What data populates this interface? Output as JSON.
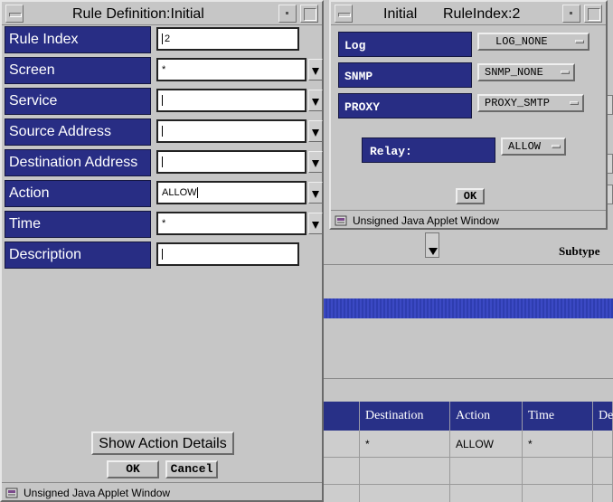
{
  "rule_definition": {
    "title": "Rule Definition:Initial",
    "fields": [
      {
        "label": "Rule Index",
        "value": "2"
      },
      {
        "label": "Screen",
        "value": "*"
      },
      {
        "label": "Service",
        "value": ""
      },
      {
        "label": "Source Address",
        "value": ""
      },
      {
        "label": "Destination Address",
        "value": ""
      },
      {
        "label": "Action",
        "value": "ALLOW"
      },
      {
        "label": "Time",
        "value": "*"
      },
      {
        "label": "Description",
        "value": ""
      }
    ],
    "show_action_details_label": "Show Action Details",
    "ok_label": "OK",
    "cancel_label": "Cancel",
    "status_text": "Unsigned Java Applet Window"
  },
  "rule_index": {
    "title_left": "Initial",
    "title_right": "RuleIndex:2",
    "rows": [
      {
        "label": "Log",
        "value": "LOG_NONE"
      },
      {
        "label": "SNMP",
        "value": "SNMP_NONE"
      },
      {
        "label": "PROXY",
        "value": "PROXY_SMTP"
      }
    ],
    "relay_label": "Relay:",
    "relay_value": "ALLOW",
    "ok_label": "OK",
    "status_text": "Unsigned Java Applet Window"
  },
  "background": {
    "subtype_label": "Subtype",
    "table": {
      "headers": [
        "",
        "Destination",
        "Action",
        "Time",
        "De"
      ],
      "rows": [
        [
          "",
          "*",
          "ALLOW",
          "*",
          ""
        ],
        [
          "",
          "",
          "",
          "",
          ""
        ],
        [
          "",
          "",
          "",
          "",
          ""
        ]
      ]
    }
  }
}
